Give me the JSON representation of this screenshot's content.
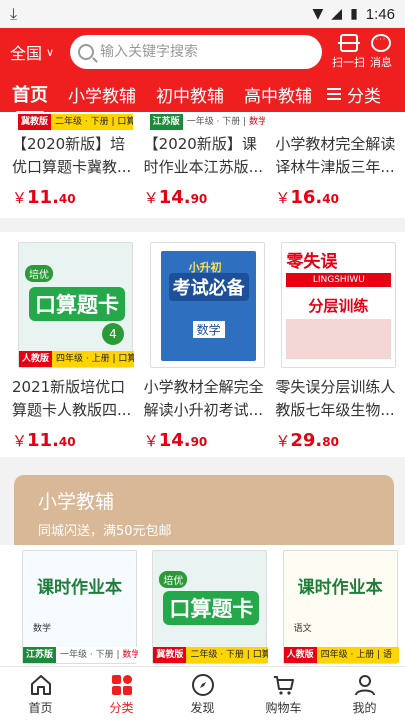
{
  "status": {
    "time": "1:46"
  },
  "header": {
    "location": "全国",
    "search_placeholder": "输入关键字搜索",
    "scan_label": "扫一扫",
    "message_label": "消息"
  },
  "tabs": [
    {
      "label": "首页"
    },
    {
      "label": "小学教辅"
    },
    {
      "label": "初中教辅"
    },
    {
      "label": "高中教辅"
    }
  ],
  "category_label": "分类",
  "section1": {
    "items": [
      {
        "edition": "冀教版",
        "grade": "二年级 · 下册",
        "subject": "口算",
        "title": "【2020新版】培优口算题卡冀教...",
        "currency": "￥",
        "price_int": "11.",
        "price_dec": "40"
      },
      {
        "edition": "江苏版",
        "grade": "一年级 · 下册",
        "subject": "数学",
        "title": "【2020新版】课时作业本江苏版...",
        "currency": "￥",
        "price_int": "14.",
        "price_dec": "90"
      },
      {
        "edition": "",
        "grade": "",
        "subject": "",
        "title": "小学教材完全解读译林牛津版三年...",
        "currency": "￥",
        "price_int": "16.",
        "price_dec": "40"
      }
    ]
  },
  "section2": {
    "items": [
      {
        "cover_main": "口算题卡",
        "cover_top": "培优",
        "edition": "人教版",
        "grade": "四年级 · 上册",
        "subject": "口算",
        "title": "2021新版培优口算题卡人教版四...",
        "currency": "￥",
        "price_int": "11.",
        "price_dec": "40"
      },
      {
        "cover_main": "考试必备",
        "cover_top": "小升初",
        "cover_sub": "数学",
        "edition": "",
        "grade": "",
        "subject": "",
        "title": "小学教材全解完全解读小升初考试...",
        "currency": "￥",
        "price_int": "14.",
        "price_dec": "90"
      },
      {
        "cover_main": "分层训练",
        "cover_top": "零失误",
        "cover_sub": "LINGSHIWU",
        "edition": "",
        "grade": "",
        "subject": "",
        "title": "零失误分层训练人教版七年级生物...",
        "currency": "￥",
        "price_int": "29.",
        "price_dec": "80"
      }
    ]
  },
  "promo": {
    "title": "小学教辅",
    "subtitle": "同城闪送，满50元包邮"
  },
  "section3": {
    "items": [
      {
        "cover_main": "课时作业本",
        "cover_sub": "数学",
        "edition": "江苏版",
        "grade": "一年级 · 下册",
        "subject": "数学"
      },
      {
        "cover_main": "口算题卡",
        "cover_top": "培优",
        "edition": "冀教版",
        "grade": "二年级 · 下册",
        "subject": "口算"
      },
      {
        "cover_main": "课时作业本",
        "cover_sub": "语文",
        "edition": "人教版",
        "grade": "四年级 · 上册",
        "subject": "语"
      }
    ]
  },
  "bottom_nav": [
    {
      "label": "首页"
    },
    {
      "label": "分类"
    },
    {
      "label": "发现"
    },
    {
      "label": "购物车"
    },
    {
      "label": "我的"
    }
  ],
  "colors": {
    "brand_red": "#ef1f1f",
    "price_red": "#e60012",
    "promo_tan": "#d8b896"
  }
}
